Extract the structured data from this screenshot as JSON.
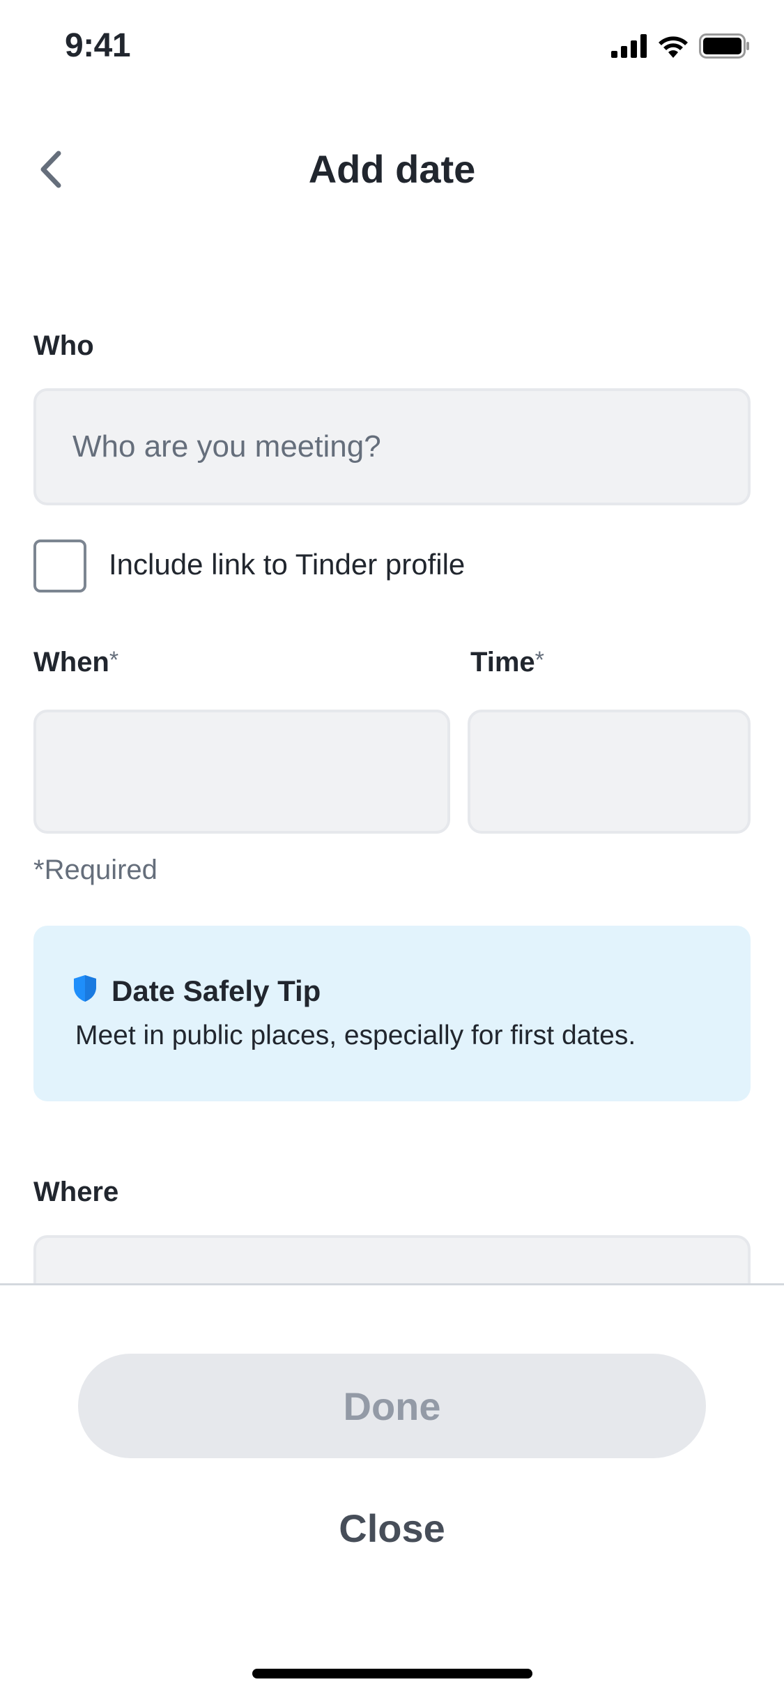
{
  "status_bar": {
    "time": "9:41"
  },
  "nav": {
    "title": "Add date"
  },
  "who": {
    "label": "Who",
    "placeholder": "Who are you meeting?",
    "value": ""
  },
  "include_link": {
    "label": "Include link to Tinder profile",
    "checked": false
  },
  "when": {
    "label": "When",
    "asterisk": "*",
    "value": ""
  },
  "time": {
    "label": "Time",
    "asterisk": "*",
    "value": ""
  },
  "required_note": "*Required",
  "tip": {
    "title": "Date Safely Tip",
    "body": "Meet in public places, especially for first dates."
  },
  "where": {
    "label": "Where",
    "value": ""
  },
  "actions": {
    "done_label": "Done",
    "close_label": "Close"
  },
  "colors": {
    "accent_blue": "#1f8efa",
    "tip_background": "#e2f3fc",
    "input_background": "#f1f2f4",
    "disabled_button": "#e6e8ec"
  }
}
